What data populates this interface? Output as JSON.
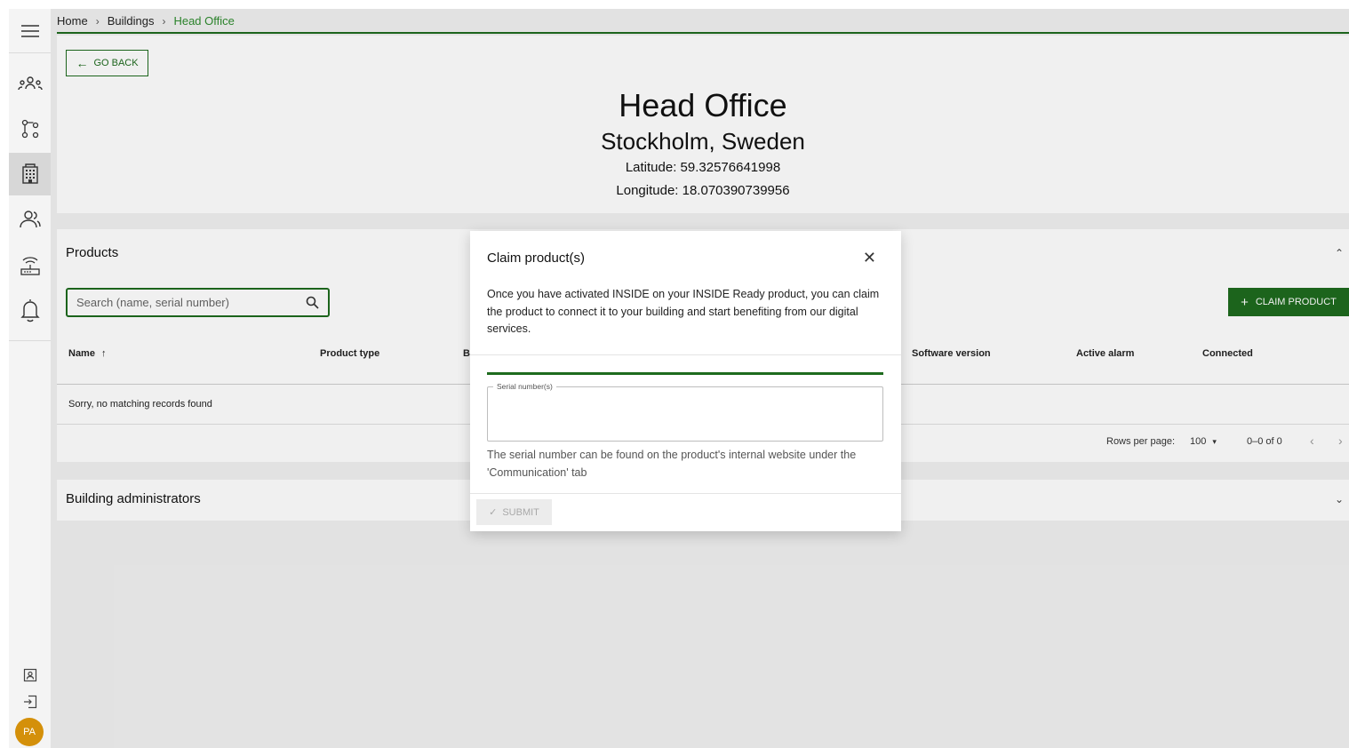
{
  "breadcrumb": {
    "home": "Home",
    "buildings": "Buildings",
    "current": "Head Office"
  },
  "header": {
    "go_back": "GO BACK",
    "title": "Head Office",
    "location": "Stockholm, Sweden",
    "latitude": "Latitude: 59.32576641998",
    "longitude": "Longitude: 18.070390739956"
  },
  "products": {
    "title": "Products",
    "search_placeholder": "Search (name, serial number)",
    "claim_button": "CLAIM PRODUCT",
    "columns": [
      "Name",
      "Product type",
      "B",
      "Software version",
      "Active alarm",
      "Connected"
    ],
    "empty_message": "Sorry, no matching records found",
    "rows_per_page_label": "Rows per page:",
    "rows_per_page_value": "100",
    "range": "0–0 of 0"
  },
  "admins": {
    "title": "Building administrators"
  },
  "dialog": {
    "title": "Claim product(s)",
    "body": "Once you have activated INSIDE on your INSIDE Ready product, you can claim the product to connect it to your building and start benefiting from our digital services.",
    "serial_label": "Serial number(s)",
    "serial_value": "",
    "help": "The serial number can be found on the product's internal website under the 'Communication' tab",
    "submit": "SUBMIT"
  },
  "user": {
    "initials": "PA"
  },
  "colors": {
    "brand_green": "#1e6b1e",
    "breadcrumb_current": "#2e8b2e",
    "avatar": "#d4900a"
  }
}
